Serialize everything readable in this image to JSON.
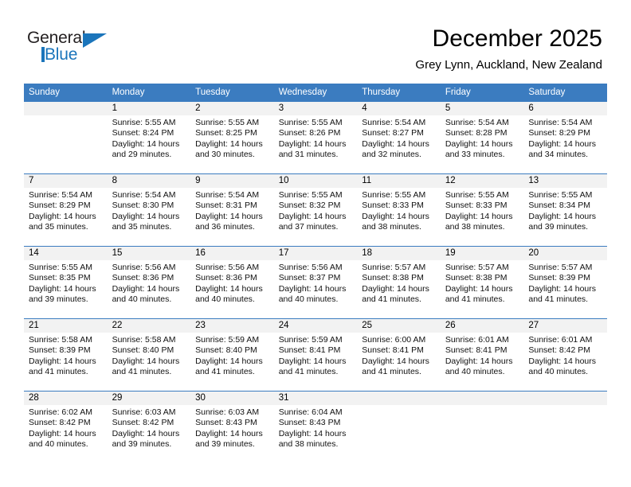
{
  "logo": {
    "word_one": "General",
    "word_two": "Blue",
    "icon": "triangle-logo-mark"
  },
  "header": {
    "title": "December 2025",
    "subtitle": "Grey Lynn, Auckland, New Zealand"
  },
  "colors": {
    "header_blue": "#3b7cc0",
    "logo_blue": "#1b75bb",
    "daynum_band": "#f2f2f2",
    "text": "#000000"
  },
  "weekdays": [
    "Sunday",
    "Monday",
    "Tuesday",
    "Wednesday",
    "Thursday",
    "Friday",
    "Saturday"
  ],
  "weeks": [
    [
      {
        "day": "",
        "sunrise": "",
        "sunset": "",
        "daylight_1": "",
        "daylight_2": "",
        "empty": true
      },
      {
        "day": "1",
        "sunrise": "Sunrise: 5:55 AM",
        "sunset": "Sunset: 8:24 PM",
        "daylight_1": "Daylight: 14 hours",
        "daylight_2": "and 29 minutes."
      },
      {
        "day": "2",
        "sunrise": "Sunrise: 5:55 AM",
        "sunset": "Sunset: 8:25 PM",
        "daylight_1": "Daylight: 14 hours",
        "daylight_2": "and 30 minutes."
      },
      {
        "day": "3",
        "sunrise": "Sunrise: 5:55 AM",
        "sunset": "Sunset: 8:26 PM",
        "daylight_1": "Daylight: 14 hours",
        "daylight_2": "and 31 minutes."
      },
      {
        "day": "4",
        "sunrise": "Sunrise: 5:54 AM",
        "sunset": "Sunset: 8:27 PM",
        "daylight_1": "Daylight: 14 hours",
        "daylight_2": "and 32 minutes."
      },
      {
        "day": "5",
        "sunrise": "Sunrise: 5:54 AM",
        "sunset": "Sunset: 8:28 PM",
        "daylight_1": "Daylight: 14 hours",
        "daylight_2": "and 33 minutes."
      },
      {
        "day": "6",
        "sunrise": "Sunrise: 5:54 AM",
        "sunset": "Sunset: 8:29 PM",
        "daylight_1": "Daylight: 14 hours",
        "daylight_2": "and 34 minutes."
      }
    ],
    [
      {
        "day": "7",
        "sunrise": "Sunrise: 5:54 AM",
        "sunset": "Sunset: 8:29 PM",
        "daylight_1": "Daylight: 14 hours",
        "daylight_2": "and 35 minutes."
      },
      {
        "day": "8",
        "sunrise": "Sunrise: 5:54 AM",
        "sunset": "Sunset: 8:30 PM",
        "daylight_1": "Daylight: 14 hours",
        "daylight_2": "and 35 minutes."
      },
      {
        "day": "9",
        "sunrise": "Sunrise: 5:54 AM",
        "sunset": "Sunset: 8:31 PM",
        "daylight_1": "Daylight: 14 hours",
        "daylight_2": "and 36 minutes."
      },
      {
        "day": "10",
        "sunrise": "Sunrise: 5:55 AM",
        "sunset": "Sunset: 8:32 PM",
        "daylight_1": "Daylight: 14 hours",
        "daylight_2": "and 37 minutes."
      },
      {
        "day": "11",
        "sunrise": "Sunrise: 5:55 AM",
        "sunset": "Sunset: 8:33 PM",
        "daylight_1": "Daylight: 14 hours",
        "daylight_2": "and 38 minutes."
      },
      {
        "day": "12",
        "sunrise": "Sunrise: 5:55 AM",
        "sunset": "Sunset: 8:33 PM",
        "daylight_1": "Daylight: 14 hours",
        "daylight_2": "and 38 minutes."
      },
      {
        "day": "13",
        "sunrise": "Sunrise: 5:55 AM",
        "sunset": "Sunset: 8:34 PM",
        "daylight_1": "Daylight: 14 hours",
        "daylight_2": "and 39 minutes."
      }
    ],
    [
      {
        "day": "14",
        "sunrise": "Sunrise: 5:55 AM",
        "sunset": "Sunset: 8:35 PM",
        "daylight_1": "Daylight: 14 hours",
        "daylight_2": "and 39 minutes."
      },
      {
        "day": "15",
        "sunrise": "Sunrise: 5:56 AM",
        "sunset": "Sunset: 8:36 PM",
        "daylight_1": "Daylight: 14 hours",
        "daylight_2": "and 40 minutes."
      },
      {
        "day": "16",
        "sunrise": "Sunrise: 5:56 AM",
        "sunset": "Sunset: 8:36 PM",
        "daylight_1": "Daylight: 14 hours",
        "daylight_2": "and 40 minutes."
      },
      {
        "day": "17",
        "sunrise": "Sunrise: 5:56 AM",
        "sunset": "Sunset: 8:37 PM",
        "daylight_1": "Daylight: 14 hours",
        "daylight_2": "and 40 minutes."
      },
      {
        "day": "18",
        "sunrise": "Sunrise: 5:57 AM",
        "sunset": "Sunset: 8:38 PM",
        "daylight_1": "Daylight: 14 hours",
        "daylight_2": "and 41 minutes."
      },
      {
        "day": "19",
        "sunrise": "Sunrise: 5:57 AM",
        "sunset": "Sunset: 8:38 PM",
        "daylight_1": "Daylight: 14 hours",
        "daylight_2": "and 41 minutes."
      },
      {
        "day": "20",
        "sunrise": "Sunrise: 5:57 AM",
        "sunset": "Sunset: 8:39 PM",
        "daylight_1": "Daylight: 14 hours",
        "daylight_2": "and 41 minutes."
      }
    ],
    [
      {
        "day": "21",
        "sunrise": "Sunrise: 5:58 AM",
        "sunset": "Sunset: 8:39 PM",
        "daylight_1": "Daylight: 14 hours",
        "daylight_2": "and 41 minutes."
      },
      {
        "day": "22",
        "sunrise": "Sunrise: 5:58 AM",
        "sunset": "Sunset: 8:40 PM",
        "daylight_1": "Daylight: 14 hours",
        "daylight_2": "and 41 minutes."
      },
      {
        "day": "23",
        "sunrise": "Sunrise: 5:59 AM",
        "sunset": "Sunset: 8:40 PM",
        "daylight_1": "Daylight: 14 hours",
        "daylight_2": "and 41 minutes."
      },
      {
        "day": "24",
        "sunrise": "Sunrise: 5:59 AM",
        "sunset": "Sunset: 8:41 PM",
        "daylight_1": "Daylight: 14 hours",
        "daylight_2": "and 41 minutes."
      },
      {
        "day": "25",
        "sunrise": "Sunrise: 6:00 AM",
        "sunset": "Sunset: 8:41 PM",
        "daylight_1": "Daylight: 14 hours",
        "daylight_2": "and 41 minutes."
      },
      {
        "day": "26",
        "sunrise": "Sunrise: 6:01 AM",
        "sunset": "Sunset: 8:41 PM",
        "daylight_1": "Daylight: 14 hours",
        "daylight_2": "and 40 minutes."
      },
      {
        "day": "27",
        "sunrise": "Sunrise: 6:01 AM",
        "sunset": "Sunset: 8:42 PM",
        "daylight_1": "Daylight: 14 hours",
        "daylight_2": "and 40 minutes."
      }
    ],
    [
      {
        "day": "28",
        "sunrise": "Sunrise: 6:02 AM",
        "sunset": "Sunset: 8:42 PM",
        "daylight_1": "Daylight: 14 hours",
        "daylight_2": "and 40 minutes."
      },
      {
        "day": "29",
        "sunrise": "Sunrise: 6:03 AM",
        "sunset": "Sunset: 8:42 PM",
        "daylight_1": "Daylight: 14 hours",
        "daylight_2": "and 39 minutes."
      },
      {
        "day": "30",
        "sunrise": "Sunrise: 6:03 AM",
        "sunset": "Sunset: 8:43 PM",
        "daylight_1": "Daylight: 14 hours",
        "daylight_2": "and 39 minutes."
      },
      {
        "day": "31",
        "sunrise": "Sunrise: 6:04 AM",
        "sunset": "Sunset: 8:43 PM",
        "daylight_1": "Daylight: 14 hours",
        "daylight_2": "and 38 minutes."
      },
      {
        "day": "",
        "sunrise": "",
        "sunset": "",
        "daylight_1": "",
        "daylight_2": "",
        "empty": true
      },
      {
        "day": "",
        "sunrise": "",
        "sunset": "",
        "daylight_1": "",
        "daylight_2": "",
        "empty": true
      },
      {
        "day": "",
        "sunrise": "",
        "sunset": "",
        "daylight_1": "",
        "daylight_2": "",
        "empty": true
      }
    ]
  ]
}
